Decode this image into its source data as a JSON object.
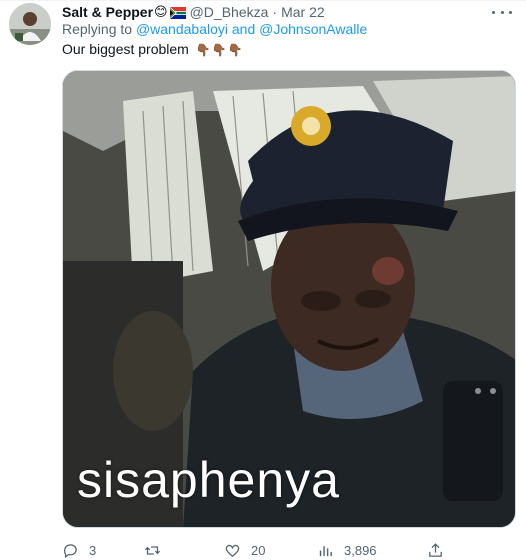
{
  "tweet": {
    "display_name": "Salt & Pepper",
    "name_emojis": "😊",
    "handle": "@D_Bhekza",
    "separator": "·",
    "date": "Mar 22",
    "replying_prefix": "Replying to",
    "mention_1": "@wandabaloyi",
    "mention_join": "and",
    "mention_2": "@JohnsonAwalle",
    "text": "Our biggest problem",
    "text_emojis": "👇🏾👇🏾👇🏾",
    "media_caption": "sisaphenya"
  },
  "actions": {
    "reply_count": "3",
    "retweet_count": "",
    "like_count": "20",
    "views_count": "3,896"
  },
  "icons": {
    "avatar": "profile-photo",
    "more": "more-dots-icon",
    "reply": "reply-bubble-icon",
    "retweet": "retweet-icon",
    "like": "heart-icon",
    "views": "views-chart-icon",
    "share": "share-icon"
  },
  "colors": {
    "link": "#1d9bf0",
    "secondary_text": "#536471",
    "primary_text": "#0f1419"
  }
}
